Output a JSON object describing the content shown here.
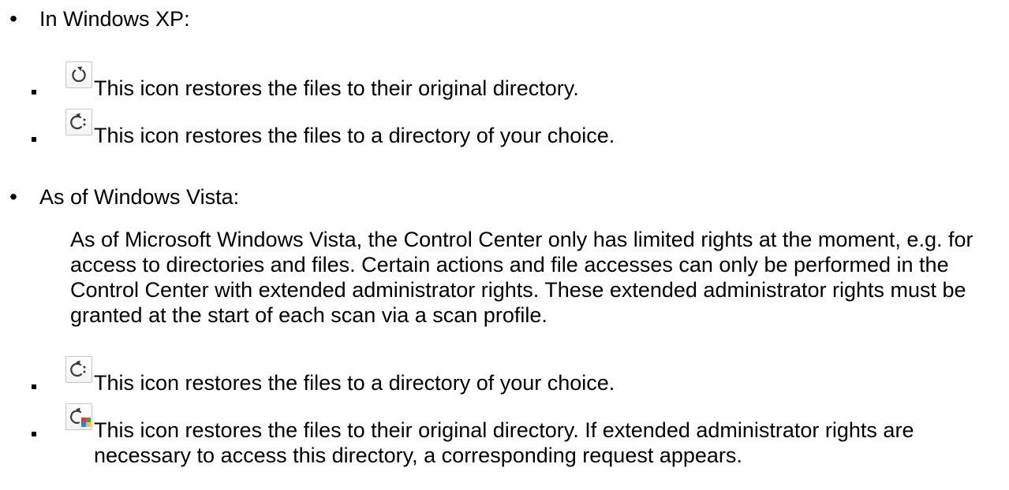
{
  "sections": [
    {
      "heading": "In Windows XP:",
      "items": [
        {
          "icon": "restore-icon",
          "text": "This icon restores the files to their original directory."
        },
        {
          "icon": "restore-to-icon",
          "text": "This icon restores the files to a directory of your choice."
        }
      ]
    },
    {
      "heading": "As of Windows Vista:",
      "paragraph": "As of Microsoft Windows Vista, the Control Center only has limited rights at the moment, e.g. for access to directories and files. Certain actions and file accesses can only be performed in the Control Center with extended administrator rights. These extended administrator rights must be granted at the start of each scan via a scan profile.",
      "items": [
        {
          "icon": "restore-to-icon",
          "text": "This icon restores the files to a directory of your choice."
        },
        {
          "icon": "restore-admin-icon",
          "text": "This icon restores the files to their original directory. If extended administrator rights are necessary to access this directory, a corresponding request appears."
        }
      ]
    }
  ],
  "colors": {
    "icon_arrow": "#3a3a3a",
    "icon_border": "#c6c6c6",
    "shield_red": "#e53935",
    "shield_green": "#43a047",
    "shield_blue": "#1e88e5",
    "shield_yellow": "#fbc02d"
  }
}
